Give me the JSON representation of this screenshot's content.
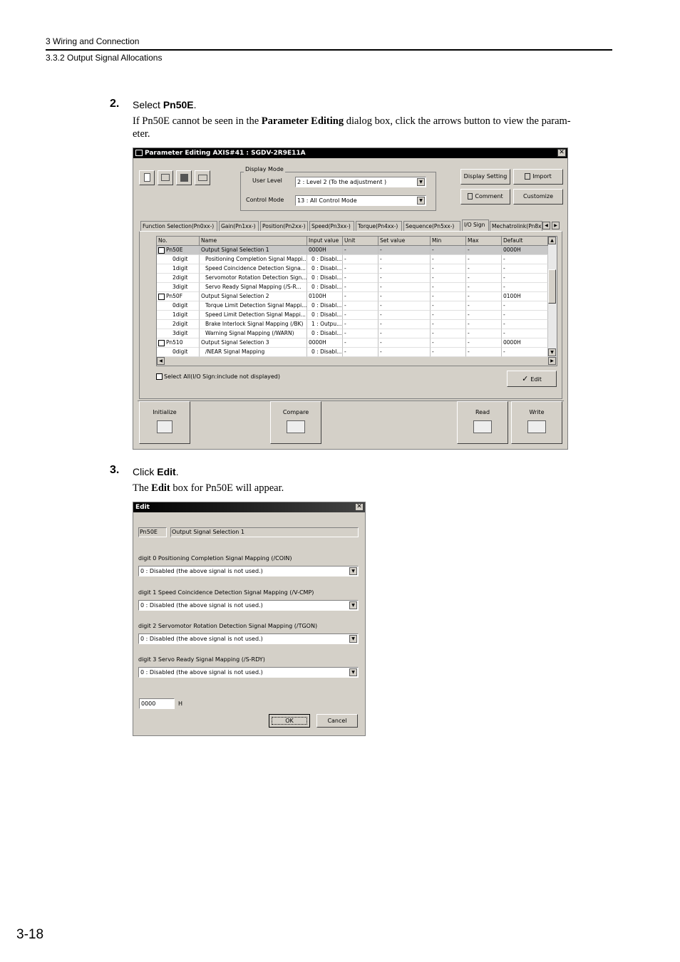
{
  "header": {
    "chapter": "3 Wiring and Connection",
    "section": "3.3.2 Output Signal Allocations"
  },
  "step2": {
    "number": "2.",
    "prefix": "Select ",
    "bold": "Pn50E",
    "suffix": ".",
    "desc_pre": "If Pn50E cannot be seen in the ",
    "desc_bold": "Parameter Editing",
    "desc_post": " dialog box, click the arrows button to view the param-",
    "desc_line2": "eter."
  },
  "param_window": {
    "title": "Parameter Editing AXIS#41 : SGDV-2R9E11A",
    "display_mode_label": "Display Mode",
    "user_level_label": "User Level",
    "user_level_value": "2 : Level 2 (To the adjustment )",
    "control_mode_label": "Control Mode",
    "control_mode_value": "13 : All Control Mode",
    "display_setting_btn": "Display Setting",
    "import_btn": "Import",
    "comment_btn": "Comment",
    "customize_btn": "Customize",
    "tabs": [
      "Function Selection(Pn0xx-)",
      "Gain(Pn1xx-)",
      "Position(Pn2xx-)",
      "Speed(Pn3xx-)",
      "Torque(Pn4xx-)",
      "Sequence(Pn5xx-)",
      "I/O Sign",
      "Mechatrolink(Pn8x"
    ],
    "columns": [
      "No.",
      "Name",
      "Input value",
      "Unit",
      "Set value",
      "Min",
      "Max",
      "Default"
    ],
    "rows": [
      {
        "no": "Pn50E",
        "name": "Output Signal Selection 1",
        "input": "0000H",
        "unit": "-",
        "set": "-",
        "min": "-",
        "max": "-",
        "def": "0000H",
        "top": true,
        "sel": true
      },
      {
        "no": "0digit",
        "name": "Positioning Completion Signal Mappi...",
        "input": "0 : Disabl...",
        "unit": "-",
        "set": "-",
        "min": "-",
        "max": "-",
        "def": "-"
      },
      {
        "no": "1digit",
        "name": "Speed Coincidence Detection Signa...",
        "input": "0 : Disabl...",
        "unit": "-",
        "set": "-",
        "min": "-",
        "max": "-",
        "def": "-"
      },
      {
        "no": "2digit",
        "name": "Servomotor Rotation Detection Sign...",
        "input": "0 : Disabl...",
        "unit": "-",
        "set": "-",
        "min": "-",
        "max": "-",
        "def": "-"
      },
      {
        "no": "3digit",
        "name": "Servo Ready Signal Mapping (/S-R...",
        "input": "0 : Disabl...",
        "unit": "-",
        "set": "-",
        "min": "-",
        "max": "-",
        "def": "-"
      },
      {
        "no": "Pn50F",
        "name": "Output Signal Selection 2",
        "input": "0100H",
        "unit": "-",
        "set": "-",
        "min": "-",
        "max": "-",
        "def": "0100H",
        "top": true
      },
      {
        "no": "0digit",
        "name": "Torque Limit Detection Signal Mappi...",
        "input": "0 : Disabl...",
        "unit": "-",
        "set": "-",
        "min": "-",
        "max": "-",
        "def": "-"
      },
      {
        "no": "1digit",
        "name": "Speed Limit Detection Signal Mappi...",
        "input": "0 : Disabl...",
        "unit": "-",
        "set": "-",
        "min": "-",
        "max": "-",
        "def": "-"
      },
      {
        "no": "2digit",
        "name": "Brake Interlock Signal Mapping (/BK)",
        "input": "1 : Outpu...",
        "unit": "-",
        "set": "-",
        "min": "-",
        "max": "-",
        "def": "-"
      },
      {
        "no": "3digit",
        "name": "Warning Signal Mapping (/WARN)",
        "input": "0 : Disabl...",
        "unit": "-",
        "set": "-",
        "min": "-",
        "max": "-",
        "def": "-"
      },
      {
        "no": "Pn510",
        "name": "Output Signal Selection 3",
        "input": "0000H",
        "unit": "-",
        "set": "-",
        "min": "-",
        "max": "-",
        "def": "0000H",
        "top": true
      },
      {
        "no": "0digit",
        "name": "/NEAR Signal Mapping",
        "input": "0 : Disabl...",
        "unit": "-",
        "set": "-",
        "min": "-",
        "max": "-",
        "def": "-"
      }
    ],
    "select_all_label": "Select All(I/O Sign:include not displayed)",
    "edit_btn": "Edit",
    "initialize_btn": "Initialize",
    "compare_btn": "Compare",
    "read_btn": "Read",
    "write_btn": "Write"
  },
  "step3": {
    "number": "3.",
    "prefix": "Click ",
    "bold": "Edit",
    "suffix": ".",
    "desc_pre": "The ",
    "desc_bold": "Edit",
    "desc_post": " box for Pn50E will appear."
  },
  "edit_window": {
    "title": "Edit",
    "param_no": "Pn50E",
    "param_name": "Output Signal Selection 1",
    "digits": [
      {
        "label": "digit 0  Positioning Completion Signal Mapping (/COIN)",
        "value": "0 : Disabled (the above signal is not used.)"
      },
      {
        "label": "digit 1  Speed Coincidence Detection Signal Mapping (/V-CMP)",
        "value": "0 : Disabled (the above signal is not used.)"
      },
      {
        "label": "digit 2  Servomotor Rotation Detection Signal Mapping (/TGON)",
        "value": "0 : Disabled (the above signal is not used.)"
      },
      {
        "label": "digit 3  Servo Ready Signal Mapping (/S-RDY)",
        "value": "0 : Disabled (the above signal is not used.)"
      }
    ],
    "hex_value": "0000",
    "hex_suffix": "H",
    "ok_btn": "OK",
    "cancel_btn": "Cancel"
  },
  "footer": {
    "page_number": "3-18"
  }
}
